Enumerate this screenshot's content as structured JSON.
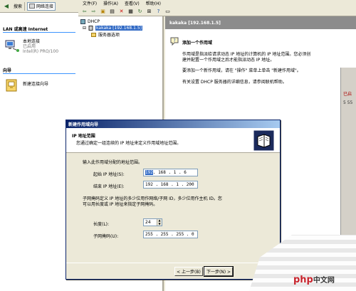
{
  "net_window": {
    "toolbar": {
      "search_label": "搜索",
      "address_label": "网络连接"
    },
    "lan_group_title": "LAN 或高速 Internet",
    "connection": {
      "name": "本地连接",
      "status": "已启用",
      "device": "Intel(R) PRO/100"
    },
    "wizard_group_title": "向导",
    "new_connection_wizard": "新建连接向导"
  },
  "dhcp_window": {
    "menu": [
      "文件(F)",
      "操作(A)",
      "查看(V)",
      "帮助(H)"
    ],
    "tree": {
      "root": "DHCP",
      "server": "kakaka [192.168.1.5]",
      "server_options": "服务器选项"
    },
    "detail": {
      "header": "kakaka [192.168.1.5]",
      "title": "添加一个作用域",
      "paras": [
        "作用域是指派给请求动态 IP 地址的计算机的 IP 地址范围。您必须创",
        "建并配置一个作用域之后才能指派动态 IP 地址。",
        "要添加一个新作用域，请在 \"操作\" 菜单上单击 \"新建作用域\"。",
        "有关设置 DHCP 服务器的详细信息，请参阅联机帮助。"
      ]
    }
  },
  "right_edge": {
    "texts": [
      "已启",
      "5 55"
    ]
  },
  "wizard": {
    "title": "新建作用域向导",
    "header_title": "IP 地址范围",
    "header_desc": "您通过确定一组连续的 IP 地址来定义作用域地址范围。",
    "section_label": "输入此作用域分配的地址范围。",
    "start_ip_label": "起始 IP 地址(S):",
    "start_ip": {
      "first": "192",
      "rest": ". 168 . 1  .  6"
    },
    "end_ip_label": "结束 IP 地址(E):",
    "end_ip": "192 . 168 . 1  . 200",
    "mask_desc_1": "子网掩码定义 IP 地址的多少位用作网络/子网 ID，多少位用作主机 ID。您",
    "mask_desc_2": "可以用长度或 IP 地址来指定子网掩码。",
    "length_label": "长度(L):",
    "length_value": "24",
    "mask_label": "子网掩码(U):",
    "mask_value": "255 . 255 . 255 .  0",
    "back_button": "< 上一步(B)",
    "next_button": "下一步(N) >"
  },
  "watermark": {
    "brand": "php",
    "suffix": "中文网"
  },
  "colors": {
    "desktop": "#3a6ea5",
    "title_bar": "#0a246a",
    "selection": "#316ac5",
    "header_gray": "#8c8c8c"
  }
}
